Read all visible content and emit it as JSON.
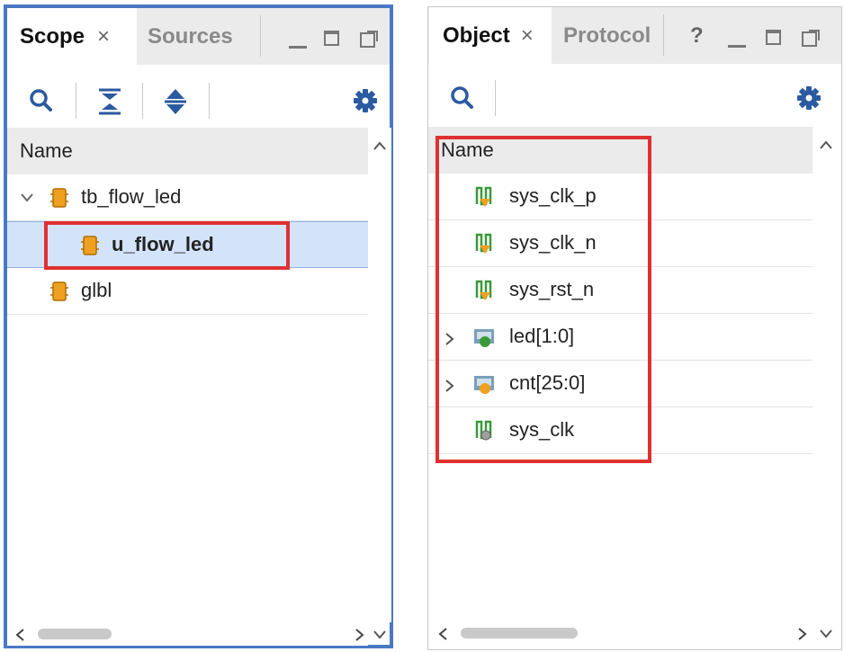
{
  "scope_panel": {
    "tabs": [
      {
        "label": "Scope",
        "active": true
      },
      {
        "label": "Sources",
        "active": false
      }
    ],
    "close_glyph": "×",
    "header": "Name",
    "tree": [
      {
        "label": "tb_flow_led",
        "expanded": true,
        "icon": "module-icon"
      },
      {
        "label": "u_flow_led",
        "selected": true,
        "icon": "module-icon"
      },
      {
        "label": "glbl",
        "icon": "module-icon"
      }
    ]
  },
  "object_panel": {
    "tabs": [
      {
        "label": "Object",
        "active": true
      },
      {
        "label": "Protocol",
        "active": false
      }
    ],
    "close_glyph": "×",
    "help_glyph": "?",
    "header": "Name",
    "objects": [
      {
        "label": "sys_clk_p",
        "icon": "input-signal-icon",
        "expandable": false
      },
      {
        "label": "sys_clk_n",
        "icon": "input-signal-icon",
        "expandable": false
      },
      {
        "label": "sys_rst_n",
        "icon": "input-signal-icon",
        "expandable": false
      },
      {
        "label": "led[1:0]",
        "icon": "output-bus-icon",
        "expandable": true
      },
      {
        "label": "cnt[25:0]",
        "icon": "internal-bus-icon",
        "expandable": true
      },
      {
        "label": "sys_clk",
        "icon": "internal-signal-icon",
        "expandable": false
      }
    ]
  },
  "colors": {
    "scope_panel_border": "#4a78c4",
    "highlight_box": "#e03030",
    "selection_background": "#d3e3f9",
    "module_icon_orange": "#f0a020"
  }
}
